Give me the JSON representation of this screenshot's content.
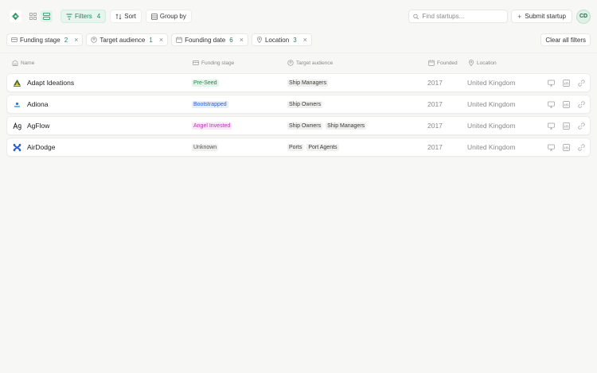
{
  "colors": {
    "accent": "#1b8a5a",
    "pre_seed_bg": "#e3f5ea",
    "pre_seed_fg": "#1e8a4c",
    "bootstrapped_bg": "#e6eefc",
    "bootstrapped_fg": "#2b5fcf",
    "angel_bg": "#f9e6f7",
    "angel_fg": "#b53bb0",
    "unknown_bg": "#efefed",
    "unknown_fg": "#555555"
  },
  "toolbar": {
    "logo_icon": "app-logo-icon",
    "filters_label": "Filters",
    "filters_count": "4",
    "sort_label": "Sort",
    "group_label": "Group by",
    "search_placeholder": "Find startups...",
    "submit_label": "Submit startup",
    "avatar_initials": "CD"
  },
  "filters": [
    {
      "label": "Funding stage",
      "count": "2"
    },
    {
      "label": "Target audience",
      "count": "1"
    },
    {
      "label": "Founding date",
      "count": "6"
    },
    {
      "label": "Location",
      "count": "3"
    }
  ],
  "clear_all_label": "Clear all filters",
  "columns": {
    "name": "Name",
    "funding": "Funding stage",
    "audience": "Target audience",
    "founded": "Founded",
    "location": "Location"
  },
  "rows": [
    {
      "name": "Adapt Ideations",
      "funding": "Pre-Seed",
      "audience": [
        "Ship Managers"
      ],
      "founded": "2017",
      "location": "United Kingdom"
    },
    {
      "name": "Adiona",
      "funding": "Bootstrapped",
      "audience": [
        "Ship Owners"
      ],
      "founded": "2017",
      "location": "United Kingdom"
    },
    {
      "name": "AgFlow",
      "funding": "Angel Invested",
      "audience": [
        "Ship Owners",
        "Ship Managers"
      ],
      "founded": "2017",
      "location": "United Kingdom"
    },
    {
      "name": "AirDodge",
      "funding": "Unknown",
      "audience": [
        "Ports",
        "Port Agents"
      ],
      "founded": "2017",
      "location": "United Kingdom"
    }
  ]
}
